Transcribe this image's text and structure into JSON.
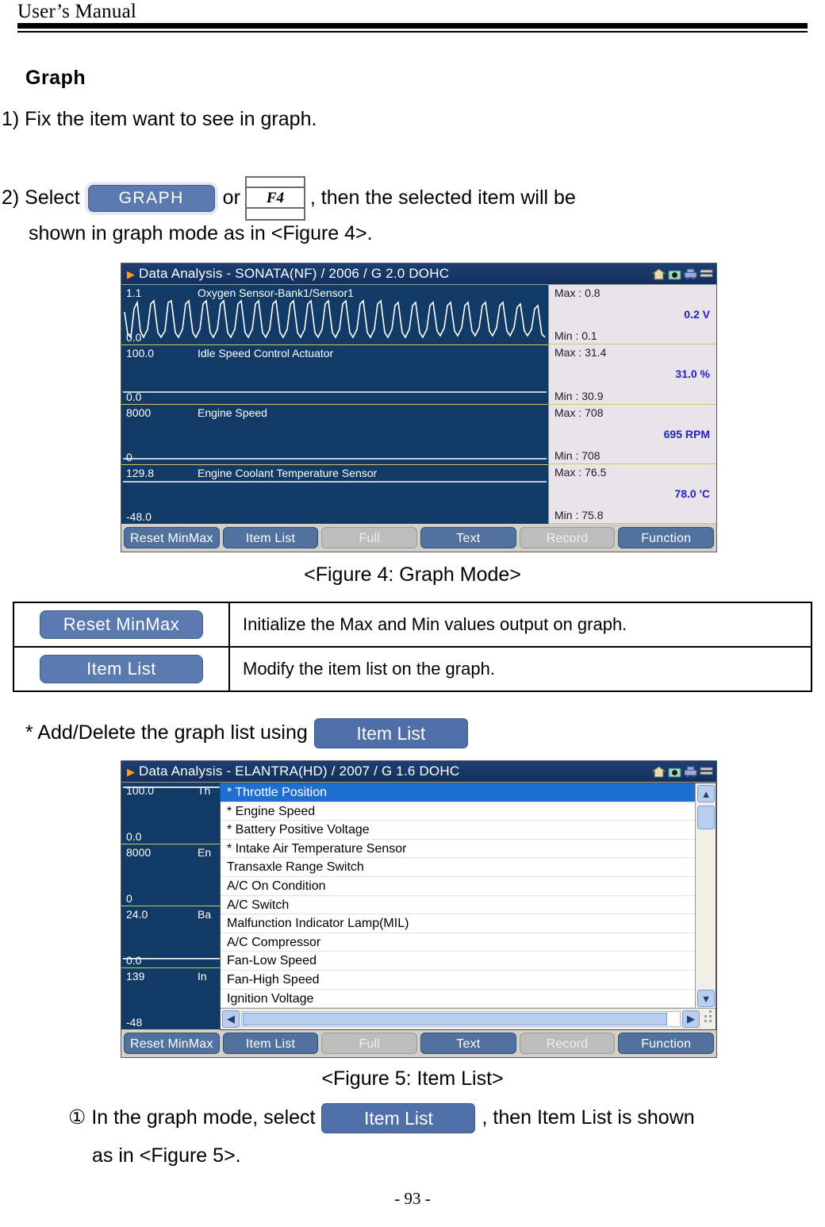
{
  "header": {
    "running_head": "User’s Manual"
  },
  "section": {
    "heading": "Graph",
    "step1": "1) Fix the item want to see in graph.",
    "step2_prefix": "2) Select",
    "step2_or": "or",
    "step2_suffix": ",  then  the  selected  item  will  be",
    "step2_continuation": "shown in graph mode as in <Figure 4>.",
    "graph_button_label": "GRAPH",
    "f4_key_label": "F4"
  },
  "figure4": {
    "caption": "<Figure 4: Graph Mode>",
    "titlebar": {
      "text": "Data Analysis - SONATA(NF) / 2006 / G 2.0 DOHC",
      "arrow": "play-arrow-icon",
      "icons": [
        "home-icon",
        "camera-icon",
        "printer-icon",
        "menu-icon"
      ]
    },
    "rows": [
      {
        "name": "Oxygen Sensor-Bank1/Sensor1",
        "scale_top": "1.1",
        "scale_bottom": "0.0",
        "max": "Max : 0.8",
        "min": "Min : 0.1",
        "value": "0.2 V",
        "plot": "oscillating"
      },
      {
        "name": "Idle Speed Control Actuator",
        "scale_top": "100.0",
        "scale_bottom": "0.0",
        "max": "Max : 31.4",
        "min": "Min : 30.9",
        "value": "31.0 %",
        "plot": "flat-low"
      },
      {
        "name": "Engine Speed",
        "scale_top": "8000",
        "scale_bottom": "0",
        "max": "Max : 708",
        "min": "Min : 708",
        "value": "695 RPM",
        "plot": "flat-bottom"
      },
      {
        "name": "Engine Coolant Temperature Sensor",
        "scale_top": "129.8",
        "scale_bottom": "-48.0",
        "max": "Max : 76.5",
        "min": "Min : 75.8",
        "value": "78.0 'C",
        "plot": "flat-top"
      }
    ],
    "buttons": [
      {
        "label": "Reset MinMax",
        "state": "enabled"
      },
      {
        "label": "Item List",
        "state": "enabled"
      },
      {
        "label": "Full",
        "state": "disabled"
      },
      {
        "label": "Text",
        "state": "enabled"
      },
      {
        "label": "Record",
        "state": "disabled"
      },
      {
        "label": "Function",
        "state": "enabled"
      }
    ]
  },
  "desc_table": {
    "rows": [
      {
        "button": "Reset MinMax",
        "description": "Initialize the Max and Min values output on graph."
      },
      {
        "button": "Item List",
        "description": "Modify the item list on the graph."
      }
    ]
  },
  "note_add_delete": {
    "text": "* Add/Delete the graph list using",
    "button": "Item List"
  },
  "figure5": {
    "caption": "<Figure 5: Item List>",
    "titlebar": {
      "text": "Data Analysis - ELANTRA(HD) / 2007 / G 1.6 DOHC",
      "arrow": "play-arrow-icon",
      "icons": [
        "home-icon",
        "camera-icon",
        "printer-icon",
        "menu-icon"
      ]
    },
    "background_rows": [
      {
        "scale_top": "100.0",
        "scale_bottom": "0.0",
        "name_clip": "Th"
      },
      {
        "scale_top": "8000",
        "scale_bottom": "0",
        "name_clip": "En"
      },
      {
        "scale_top": "24.0",
        "scale_bottom": "0.0",
        "name_clip": "Ba"
      },
      {
        "scale_top": "139",
        "scale_bottom": "-48",
        "name_clip": "In"
      }
    ],
    "item_list": [
      {
        "label": "* Throttle Position",
        "selected": true
      },
      {
        "label": "* Engine Speed",
        "selected": false
      },
      {
        "label": "* Battery Positive Voltage",
        "selected": false
      },
      {
        "label": "* Intake Air Temperature Sensor",
        "selected": false
      },
      {
        "label": "  Transaxle Range Switch",
        "selected": false
      },
      {
        "label": "  A/C On Condition",
        "selected": false
      },
      {
        "label": "  A/C Switch",
        "selected": false
      },
      {
        "label": "  Malfunction Indicator Lamp(MIL)",
        "selected": false
      },
      {
        "label": "  A/C Compressor",
        "selected": false
      },
      {
        "label": "  Fan-Low Speed",
        "selected": false
      },
      {
        "label": "  Fan-High Speed",
        "selected": false
      },
      {
        "label": "  Ignition Voltage",
        "selected": false
      }
    ],
    "scrollbar": {
      "up_arrow": "chevron-up-icon",
      "down_arrow": "chevron-down-icon",
      "left_arrow": "chevron-left-icon",
      "right_arrow": "chevron-right-icon"
    },
    "buttons": [
      {
        "label": "Reset MinMax",
        "state": "enabled"
      },
      {
        "label": "Item List",
        "state": "enabled"
      },
      {
        "label": "Full",
        "state": "disabled"
      },
      {
        "label": "Text",
        "state": "enabled"
      },
      {
        "label": "Record",
        "state": "disabled"
      },
      {
        "label": "Function",
        "state": "enabled"
      }
    ]
  },
  "note_circle1": {
    "prefix": "① In the graph mode, select",
    "button": "Item List",
    "suffix": ", then Item List is shown",
    "continuation": "as in <Figure 5>."
  },
  "footer": {
    "page_number": "- 93 -"
  },
  "colors": {
    "graph_background": "#123a66",
    "panel_background": "#e9e3ea",
    "titlebar": "#12305c",
    "button_blue": "#51729f",
    "button_disabled": "#bdbdbd",
    "value_text": "#2222cc",
    "selection": "#1f6fd0",
    "row_divider": "#c9c96a"
  }
}
